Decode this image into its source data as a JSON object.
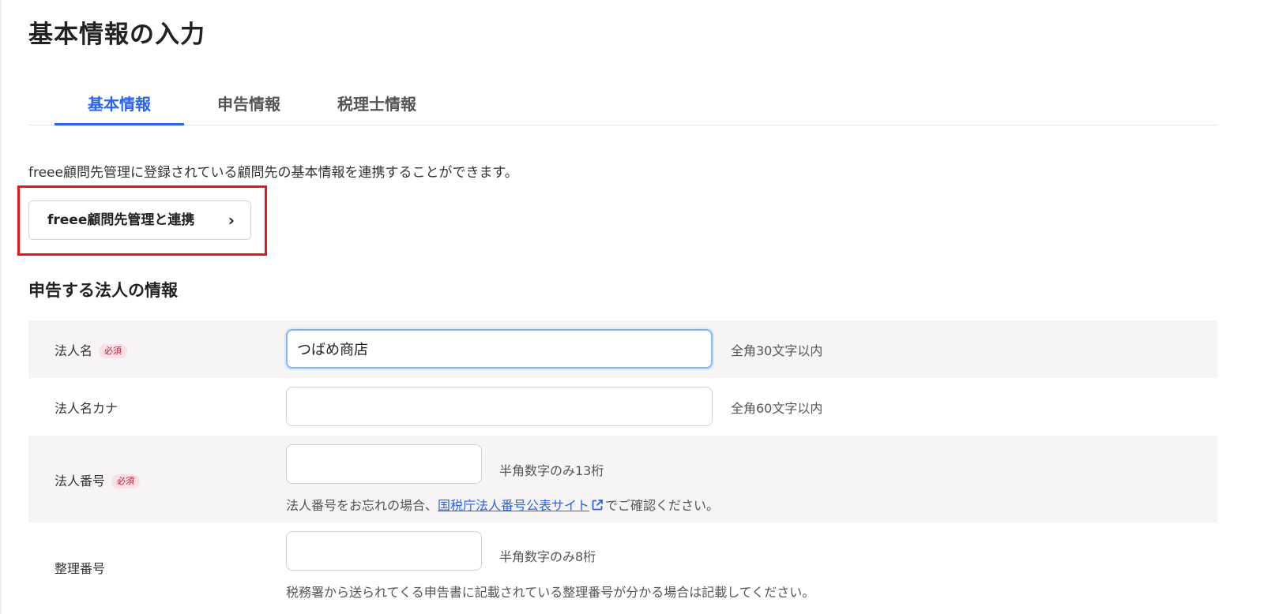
{
  "page": {
    "title": "基本情報の入力"
  },
  "tabs": [
    {
      "label": "基本情報",
      "active": true
    },
    {
      "label": "申告情報",
      "active": false
    },
    {
      "label": "税理士情報",
      "active": false
    }
  ],
  "intro_text": "freee顧問先管理に登録されている顧問先の基本情報を連携することができます。",
  "link_button": {
    "label": "freee顧問先管理と連携",
    "chevron": "›"
  },
  "section_title": "申告する法人の情報",
  "required_badge": "必須",
  "fields": {
    "corp_name": {
      "label": "法人名",
      "value": "つばめ商店",
      "hint": "全角30文字以内"
    },
    "corp_name_kana": {
      "label": "法人名カナ",
      "value": "",
      "hint": "全角60文字以内"
    },
    "corp_number": {
      "label": "法人番号",
      "value": "",
      "hint": "半角数字のみ13桁",
      "note_before": "法人番号をお忘れの場合、",
      "note_link": "国税庁法人番号公表サイト",
      "note_after": "でご確認ください。"
    },
    "ref_number": {
      "label": "整理番号",
      "value": "",
      "hint": "半角数字のみ8桁",
      "note": "税務署から送られてくる申告書に記載されている整理番号が分かる場合は記載してください。"
    }
  },
  "icons": {
    "external_link": "external-link-icon"
  },
  "colors": {
    "accent": "#2864f0",
    "highlight": "#e5141f",
    "required_bg": "#fbdfe4"
  }
}
